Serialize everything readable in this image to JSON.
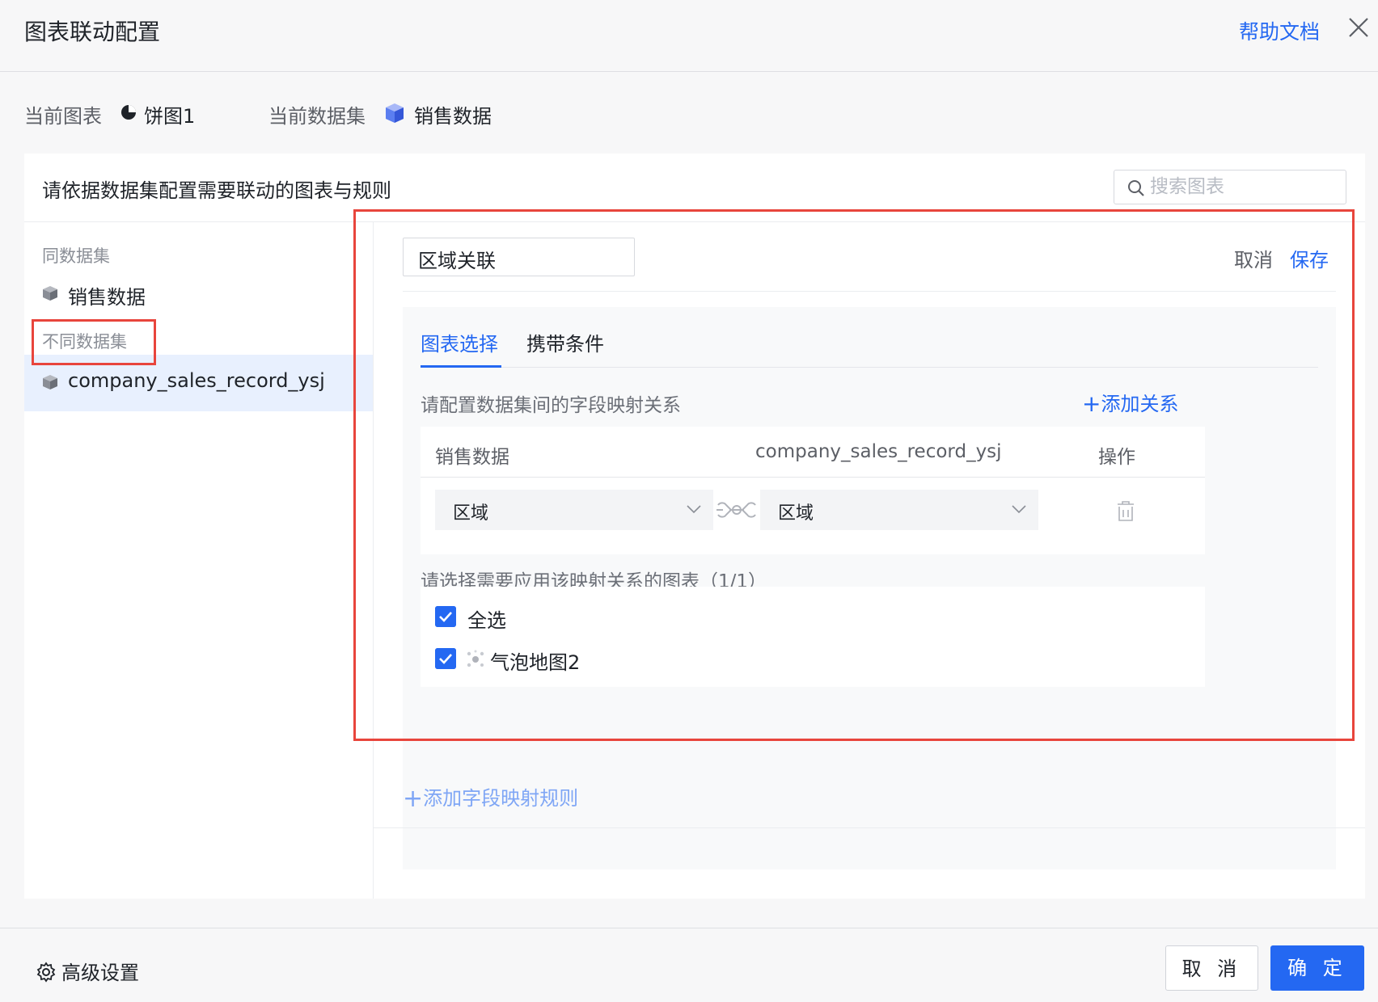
{
  "header": {
    "title": "图表联动配置",
    "help_link": "帮助文档"
  },
  "info": {
    "current_chart_label": "当前图表",
    "current_chart_value": "饼图1",
    "current_dataset_label": "当前数据集",
    "current_dataset_value": "销售数据"
  },
  "panel": {
    "title": "请依据数据集配置需要联动的图表与规则",
    "search_placeholder": "搜索图表"
  },
  "left": {
    "same_group_label": "同数据集",
    "same_items": [
      "销售数据"
    ],
    "diff_group_label": "不同数据集",
    "diff_items": [
      "company_sales_record_ysj"
    ],
    "active_item": "company_sales_record_ysj"
  },
  "rule": {
    "name": "区域关联",
    "cancel": "取消",
    "save": "保存",
    "tabs": [
      "图表选择",
      "携带条件"
    ],
    "active_tab": "图表选择",
    "mapping_hint": "请配置数据集间的字段映射关系",
    "add_relation": "添加关系",
    "table": {
      "headers": [
        "销售数据",
        "company_sales_record_ysj",
        "操作"
      ],
      "rows": [
        {
          "left_field": "区域",
          "right_field": "区域"
        }
      ]
    },
    "apply_hint": "请选择需要应用该映射关系的图表（1/1）",
    "checkboxes": [
      {
        "label": "全选",
        "checked": true
      },
      {
        "label": "气泡地图2",
        "checked": true
      }
    ],
    "add_rule": "添加字段映射规则"
  },
  "footer": {
    "advanced": "高级设置",
    "cancel": "取 消",
    "ok": "确 定"
  },
  "colors": {
    "accent": "#2468f2",
    "highlight_box": "#e8453c",
    "active_row_bg": "#e8f0fe"
  }
}
